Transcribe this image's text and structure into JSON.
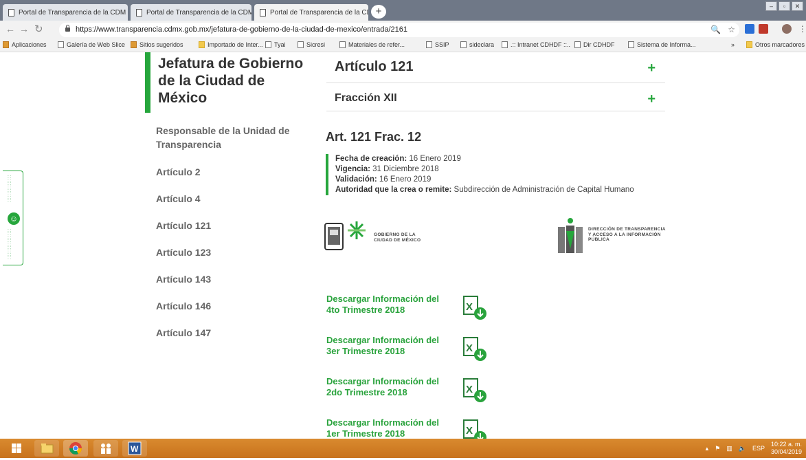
{
  "browser": {
    "tabs": [
      {
        "title": "Portal de Transparencia de la CDM",
        "close": "×"
      },
      {
        "title": "Portal de Transparencia de la CDM",
        "close": "×"
      },
      {
        "title": "Portal de Transparencia de la CDM",
        "close": "×"
      }
    ],
    "new_tab": "+",
    "url": "https://www.transparencia.cdmx.gob.mx/jefatura-de-gobierno-de-la-ciudad-de-mexico/entrada/2161",
    "bookmarks": [
      {
        "label": "Aplicaciones",
        "icon": "apps-grid-icon"
      },
      {
        "label": "Galería de Web Slice",
        "icon": "page-icon"
      },
      {
        "label": "Sitios sugeridos",
        "icon": "sites-icon"
      },
      {
        "label": "Importado de Inter...",
        "icon": "folder-icon"
      },
      {
        "label": "Tyai",
        "icon": "page-icon"
      },
      {
        "label": "Sicresi",
        "icon": "page-icon"
      },
      {
        "label": "Materiales de refer...",
        "icon": "page-icon"
      },
      {
        "label": "SSIP",
        "icon": "image-icon"
      },
      {
        "label": "sideclara",
        "icon": "image-icon"
      },
      {
        "label": ".:: Intranet CDHDF ::..",
        "icon": "site-icon"
      },
      {
        "label": "Dir CDHDF",
        "icon": "site-icon"
      },
      {
        "label": "Sistema de Informa...",
        "icon": "site-icon"
      }
    ],
    "bookmarks_overflow": "»",
    "other_bookmarks": "Otros marcadores"
  },
  "sidebar": {
    "title": "Jefatura de Gobierno de la Ciudad de México",
    "items": [
      {
        "label": "Responsable de la Unidad de Transparencia"
      },
      {
        "label": "Artículo 2"
      },
      {
        "label": "Artículo 4"
      },
      {
        "label": "Artículo 121"
      },
      {
        "label": "Artículo 123"
      },
      {
        "label": "Artículo 143"
      },
      {
        "label": "Artículo 146"
      },
      {
        "label": "Artículo 147"
      }
    ]
  },
  "main": {
    "accordion_articulo": {
      "label": "Artículo 121",
      "toggle": "+"
    },
    "accordion_fraccion": {
      "label": "Fracción XII",
      "toggle": "+"
    },
    "fraccion_title": "Art. 121 Frac. 12",
    "meta": {
      "fecha_label": "Fecha de creación:",
      "fecha_value": " 16 Enero 2019",
      "vigencia_label": "Vigencia:",
      "vigencia_value": " 31 Diciembre 2018",
      "validacion_label": "Validación:",
      "validacion_value": " 16 Enero 2019",
      "autoridad_label": "Autoridad que la crea o remite:",
      "autoridad_value": " Subdirección de Administración de Capital Humano"
    },
    "logo_gobierno": {
      "line1": "GOBIERNO DE LA",
      "line2": "CIUDAD DE MÉXICO"
    },
    "logo_direccion": {
      "line1": "DIRECCIÓN DE TRANSPARENCIA",
      "line2": "Y ACCESO A LA INFORMACIÓN",
      "line3": "PÚBLICA"
    },
    "downloads": [
      {
        "line1": "Descargar Información del",
        "line2": "4to Trimestre 2018"
      },
      {
        "line1": "Descargar Información del",
        "line2": "3er Trimestre 2018"
      },
      {
        "line1": "Descargar Información del",
        "line2": "2do Trimestre 2018"
      },
      {
        "line1": "Descargar Información del",
        "line2": "1er Trimestre 2018"
      }
    ]
  },
  "taskbar": {
    "language": "ESP",
    "time": "10:22 a. m.",
    "date": "30/04/2019"
  },
  "colors": {
    "accent_green": "#26a63c",
    "taskbar": "#d98a2f",
    "tabstrip": "#6f7887"
  }
}
